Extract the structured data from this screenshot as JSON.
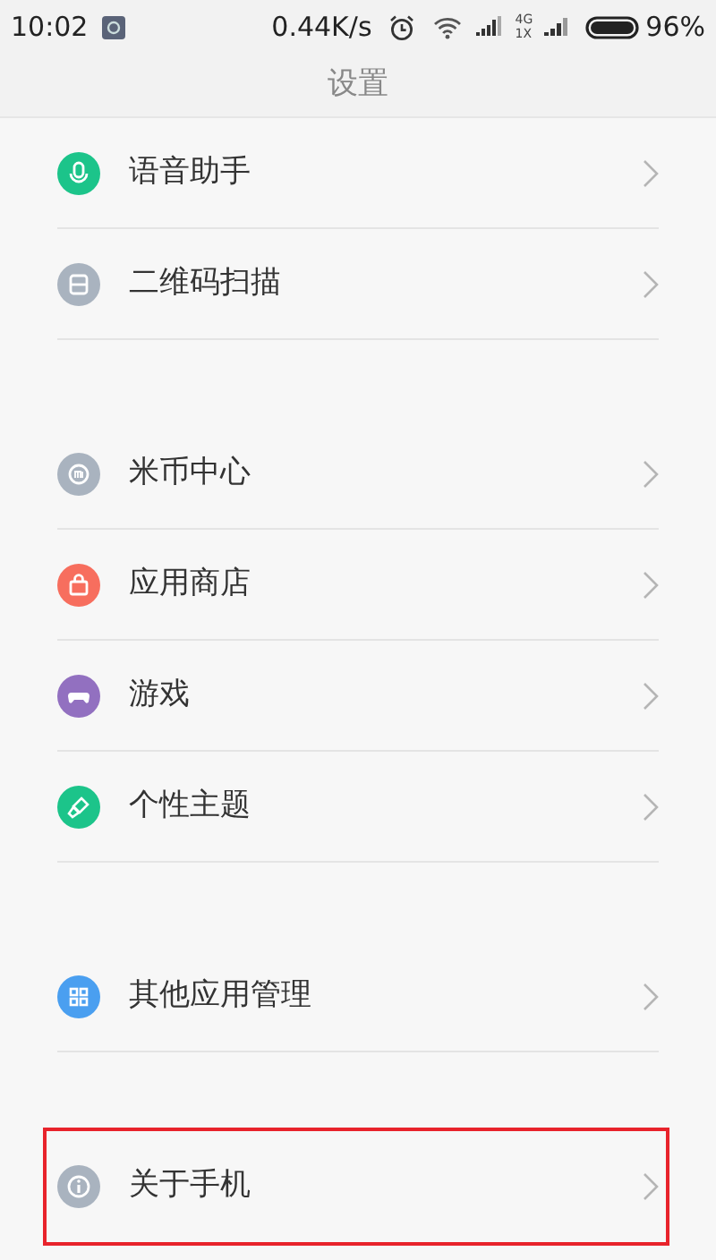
{
  "status_bar": {
    "time": "10:02",
    "speed": "0.44K/s",
    "network_top": "4G",
    "network_bottom": "1X",
    "battery": "96%"
  },
  "title": "设置",
  "groups": [
    {
      "items": [
        {
          "label": "语音助手",
          "color": "#1cc48a",
          "highlighted": false
        },
        {
          "label": "二维码扫描",
          "color": "#a9b3bf",
          "highlighted": false
        }
      ]
    },
    {
      "items": [
        {
          "label": "米币中心",
          "color": "#a9b3bf",
          "highlighted": false
        },
        {
          "label": "应用商店",
          "color": "#f76e5e",
          "highlighted": false
        },
        {
          "label": "游戏",
          "color": "#9270c0",
          "highlighted": false
        },
        {
          "label": "个性主题",
          "color": "#1cc48a",
          "highlighted": false
        }
      ]
    },
    {
      "items": [
        {
          "label": "其他应用管理",
          "color": "#4a9ff0",
          "highlighted": false
        }
      ]
    },
    {
      "items": [
        {
          "label": "关于手机",
          "color": "#a9b3bf",
          "highlighted": true
        }
      ]
    }
  ]
}
